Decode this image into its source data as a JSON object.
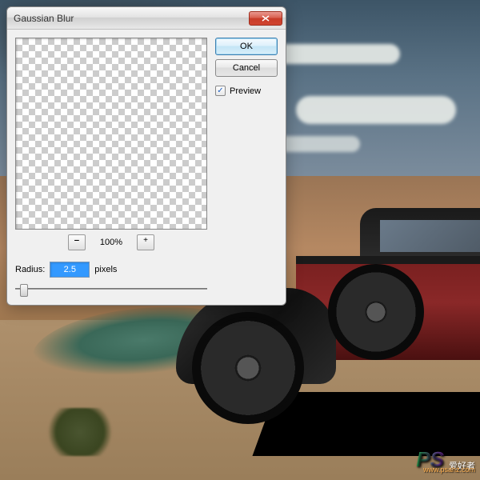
{
  "dialog": {
    "title": "Gaussian Blur",
    "zoom_level": "100%",
    "radius_label": "Radius:",
    "radius_value": "2.5",
    "radius_unit": "pixels",
    "buttons": {
      "ok": "OK",
      "cancel": "Cancel"
    },
    "preview_label": "Preview",
    "preview_checked": true
  },
  "watermark": {
    "logo": "PS",
    "text_cn": "爱好者",
    "url": "www.psahz.com"
  }
}
